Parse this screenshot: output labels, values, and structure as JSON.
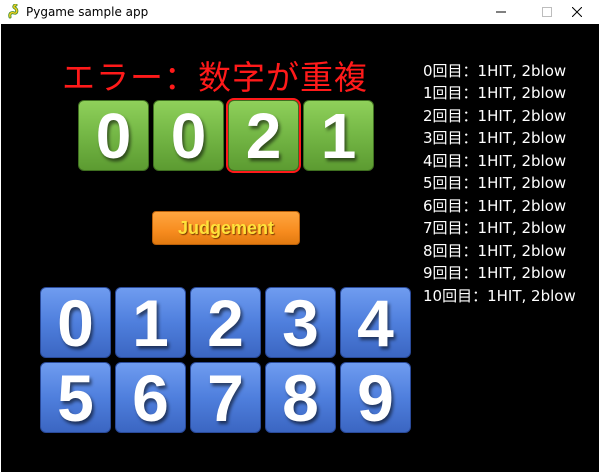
{
  "window": {
    "title": "Pygame sample app",
    "icon": "pygame-snake-icon"
  },
  "game": {
    "error_message": "エラー：数字が重複",
    "guess_digits": [
      "0",
      "0",
      "2",
      "1"
    ],
    "selected_slot": 2,
    "judge_label": "Judgement",
    "keypad_digits": [
      "0",
      "1",
      "2",
      "3",
      "4",
      "5",
      "6",
      "7",
      "8",
      "9"
    ],
    "history": [
      "0回目：1HIT, 2blow",
      "1回目：1HIT, 2blow",
      "2回目：1HIT, 2blow",
      "3回目：1HIT, 2blow",
      "4回目：1HIT, 2blow",
      "5回目：1HIT, 2blow",
      "6回目：1HIT, 2blow",
      "7回目：1HIT, 2blow",
      "8回目：1HIT, 2blow",
      "9回目：1HIT, 2blow",
      "10回目：1HIT, 2blow"
    ]
  },
  "colors": {
    "background": "#000000",
    "error_text": "#ff1a1a",
    "guess_tile": "#76b947",
    "keypad_tile": "#4f7fdd",
    "judge_button": "#f78c1f",
    "judge_text": "#ffe23a"
  }
}
